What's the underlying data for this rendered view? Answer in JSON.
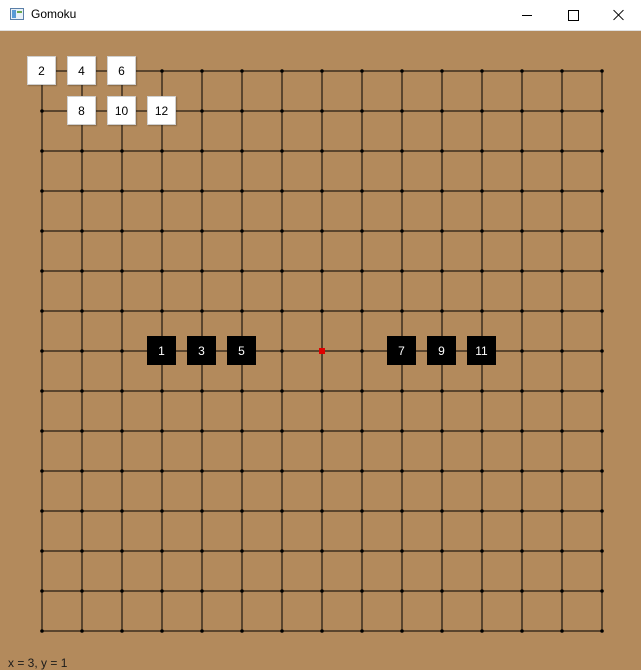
{
  "window": {
    "title": "Gomoku",
    "icon": "app-window-icon",
    "buttons": [
      "minimize-icon",
      "maximize-icon",
      "close-icon"
    ]
  },
  "board": {
    "size": 15,
    "background_color": "#b38a5c",
    "line_color": "#000000",
    "last_move_marker_color": "#e00000",
    "last_move_marker": {
      "col": 7,
      "row": 7
    }
  },
  "stones": [
    {
      "label": "1",
      "color": "black",
      "col": 3,
      "row": 7
    },
    {
      "label": "2",
      "color": "white",
      "col": 0,
      "row": 0
    },
    {
      "label": "3",
      "color": "black",
      "col": 4,
      "row": 7
    },
    {
      "label": "4",
      "color": "white",
      "col": 1,
      "row": 0
    },
    {
      "label": "5",
      "color": "black",
      "col": 5,
      "row": 7
    },
    {
      "label": "6",
      "color": "white",
      "col": 2,
      "row": 0
    },
    {
      "label": "7",
      "color": "black",
      "col": 9,
      "row": 7
    },
    {
      "label": "8",
      "color": "white",
      "col": 1,
      "row": 1
    },
    {
      "label": "9",
      "color": "black",
      "col": 10,
      "row": 7
    },
    {
      "label": "10",
      "color": "white",
      "col": 2,
      "row": 1
    },
    {
      "label": "11",
      "color": "black",
      "col": 11,
      "row": 7
    },
    {
      "label": "12",
      "color": "white",
      "col": 3,
      "row": 1
    }
  ],
  "status": {
    "text": "x = 3, y = 1"
  }
}
